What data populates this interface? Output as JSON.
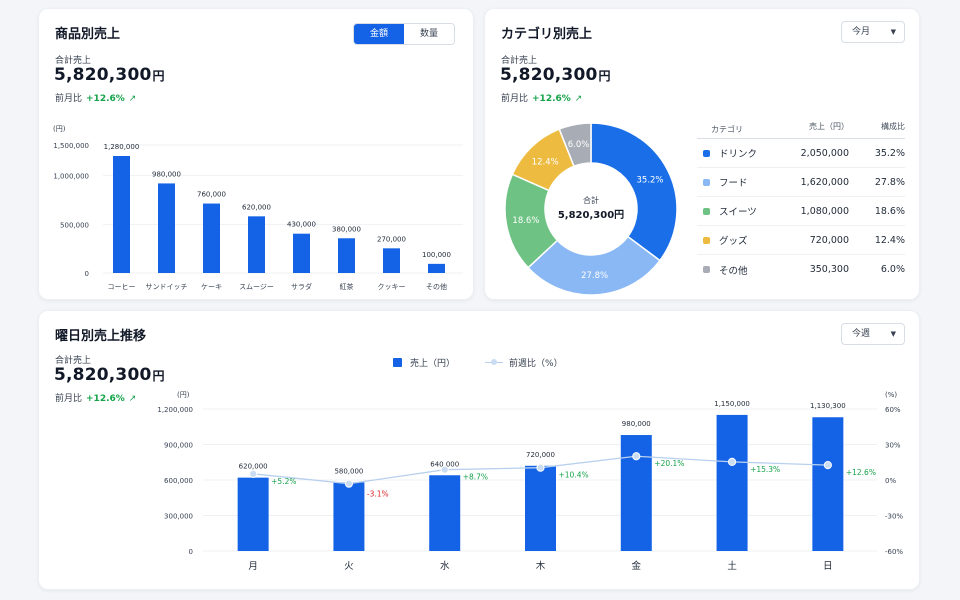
{
  "colors": {
    "bar": "#1463e6",
    "line": "#b8d0ee",
    "positive": "#16a34a",
    "negative": "#dc2626",
    "grid": "#eef1f4"
  },
  "product": {
    "title": "商品別売上",
    "toggle": [
      "金額",
      "数量"
    ],
    "summary": {
      "label": "合計売上",
      "value": "5,820,300",
      "unit": "円",
      "change_label": "前月比",
      "change": "+12.6%",
      "arrow": "↗"
    }
  },
  "category": {
    "title": "カテゴリ別売上",
    "dropdown": "今月",
    "summary": {
      "label": "合計売上",
      "value": "5,820,300",
      "unit": "円",
      "change_label": "前月比",
      "change": "+12.6%",
      "arrow": "↗"
    },
    "donut_center_label": "合計",
    "donut_center_value": "5,820,300円",
    "table_headers": [
      "カテゴリ",
      "売上（円）",
      "構成比"
    ]
  },
  "weekday": {
    "title": "曜日別売上推移",
    "dropdown": "今週",
    "summary": {
      "label": "合計売上",
      "value": "5,820,300",
      "unit": "円",
      "change_label": "前月比",
      "change": "+12.6%",
      "arrow": "↗"
    },
    "legend": [
      "売上（円）",
      "前週比（%）"
    ]
  },
  "chart_data": [
    {
      "type": "bar",
      "title": "",
      "ylabel": "(円)",
      "categories": [
        "コーヒー",
        "サンドイッチ",
        "ケーキ",
        "スムージー",
        "サラダ",
        "紅茶",
        "クッキー",
        "その他"
      ],
      "values": [
        1280000,
        980000,
        760000,
        620000,
        430000,
        380000,
        270000,
        100000
      ],
      "data_labels": [
        "1,280,000",
        "980,000",
        "760,000",
        "620,000",
        "430,000",
        "380,000",
        "270,000",
        "100,000"
      ],
      "yticks": [
        "0",
        "500,000",
        "1,000,000",
        "1,500,000"
      ],
      "ylim": [
        0,
        1500000
      ],
      "grid": true
    },
    {
      "type": "pie",
      "title": "",
      "categories": [
        "ドリンク",
        "フード",
        "スイーツ",
        "グッズ",
        "その他"
      ],
      "values": [
        2050000,
        1620000,
        1080000,
        720000,
        350300
      ],
      "value_labels": [
        "2,050,000",
        "1,620,000",
        "1,080,000",
        "720,000",
        "350,300"
      ],
      "percent_labels": [
        "35.2%",
        "27.8%",
        "18.6%",
        "12.4%",
        "6.0%"
      ],
      "colors": [
        "#1a6fe8",
        "#8ab8f4",
        "#6ec283",
        "#edbb40",
        "#a8adb5"
      ],
      "donut": true
    },
    {
      "type": "bar",
      "title": "",
      "categories": [
        "月",
        "火",
        "水",
        "木",
        "金",
        "土",
        "日"
      ],
      "series": [
        {
          "name": "売上（円）",
          "type": "bar",
          "values": [
            620000,
            580000,
            640000,
            720000,
            980000,
            1150000,
            1130300
          ],
          "labels": [
            "620,000",
            "580,000",
            "640,000",
            "720,000",
            "980,000",
            "1,150,000",
            "1,130,300"
          ]
        },
        {
          "name": "前週比（%）",
          "type": "line",
          "values": [
            5.2,
            -3.1,
            8.7,
            10.4,
            20.1,
            15.3,
            12.6
          ],
          "labels": [
            "+5.2%",
            "-3.1%",
            "+8.7%",
            "+10.4%",
            "+20.1%",
            "+15.3%",
            "+12.6%"
          ]
        }
      ],
      "ylabel_left": "(円)",
      "ylabel_right": "(%)",
      "yticks_left": [
        "0",
        "300,000",
        "600,000",
        "900,000",
        "1,200,000"
      ],
      "yticks_right": [
        "-60%",
        "-30%",
        "0%",
        "30%",
        "60%"
      ],
      "ylim_left": [
        0,
        1200000
      ],
      "ylim_right": [
        -60,
        60
      ],
      "grid": true
    }
  ]
}
